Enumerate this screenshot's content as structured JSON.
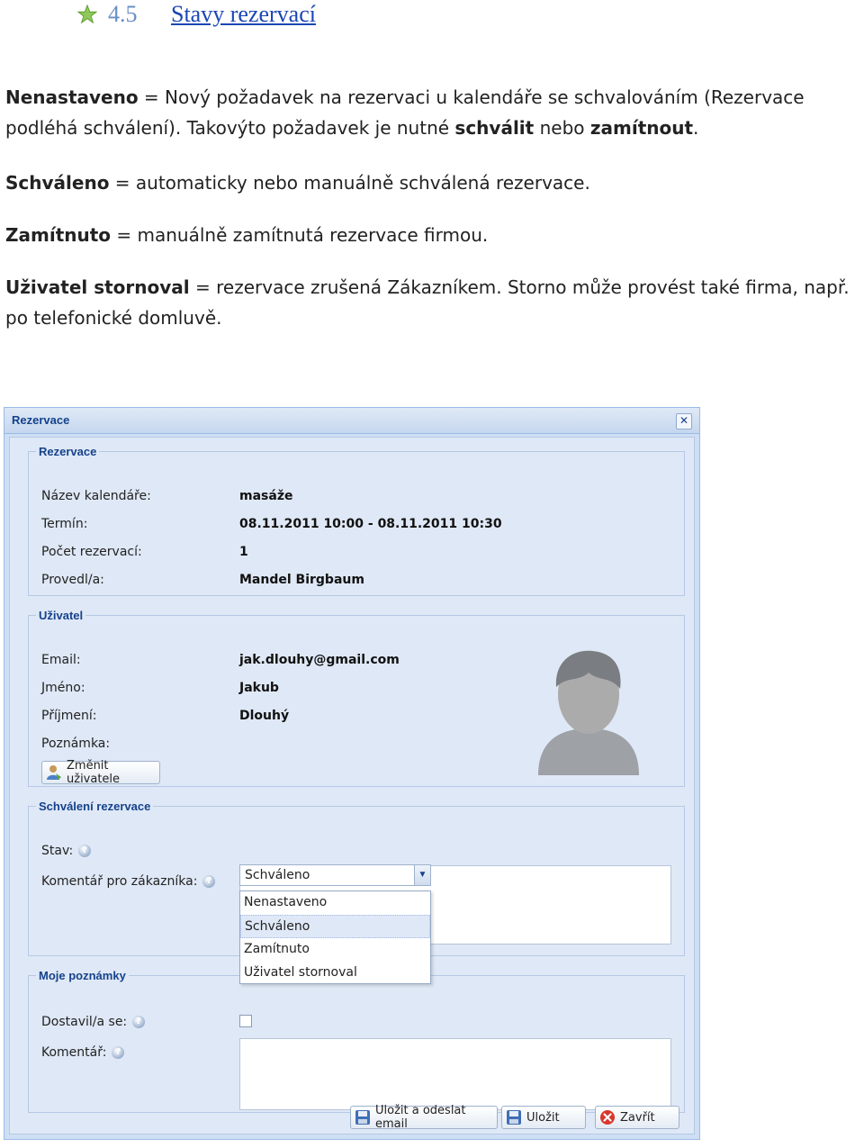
{
  "doc": {
    "section_number": "4.5",
    "section_title": "Stavy rezervací",
    "p1": {
      "term": "Nenastaveno",
      "text1": " = Nový požadavek na rezervaci u kalendáře se schvalováním (Rezervace podléhá schválení). Takovýto požadavek je nutné ",
      "b1": "schválit",
      "text2": " nebo ",
      "b2": "zamítnout",
      "text3": "."
    },
    "p2": {
      "term": "Schváleno",
      "text": " = automaticky nebo manuálně schválená rezervace."
    },
    "p3": {
      "term": "Zamítnuto",
      "text": " = manuálně zamítnutá rezervace firmou."
    },
    "p4": {
      "term": "Uživatel stornoval",
      "text": " = rezervace zrušená Zákazníkem. Storno může provést také firma, např. po telefonické domluvě."
    }
  },
  "dialog": {
    "title": "Rezervace",
    "close_symbol": "✕",
    "rezervace": {
      "legend": "Rezervace",
      "name_label": "Název kalendáře:",
      "name_value": "masáže",
      "term_label": "Termín:",
      "term_value": "08.11.2011 10:00 - 08.11.2011 10:30",
      "count_label": "Počet rezervací:",
      "count_value": "1",
      "by_label": "Provedl/a:",
      "by_value": "Mandel Birgbaum"
    },
    "user": {
      "legend": "Uživatel",
      "email_label": "Email:",
      "email_value": "jak.dlouhy@gmail.com",
      "first_label": "Jméno:",
      "first_value": "Jakub",
      "last_label": "Příjmení:",
      "last_value": "Dlouhý",
      "note_label": "Poznámka:",
      "change_button": "Změnit uživatele"
    },
    "approval": {
      "legend": "Schválení rezervace",
      "state_label": "Stav:",
      "state_value": "Schváleno",
      "comment_label": "Komentář pro zákazníka:",
      "options": [
        "Nenastaveno",
        "Schváleno",
        "Zamítnuto",
        "Uživatel stornoval"
      ]
    },
    "notes": {
      "legend": "Moje poznámky",
      "attended_label": "Dostavil/a se:",
      "comment_label": "Komentář:"
    },
    "buttons": {
      "save_send": "Uložit a odeslat email",
      "save": "Uložit",
      "close": "Zavřít"
    },
    "colors": {
      "accent": "#15428b",
      "panel": "#dfe8f6",
      "border": "#99bbe8"
    }
  }
}
